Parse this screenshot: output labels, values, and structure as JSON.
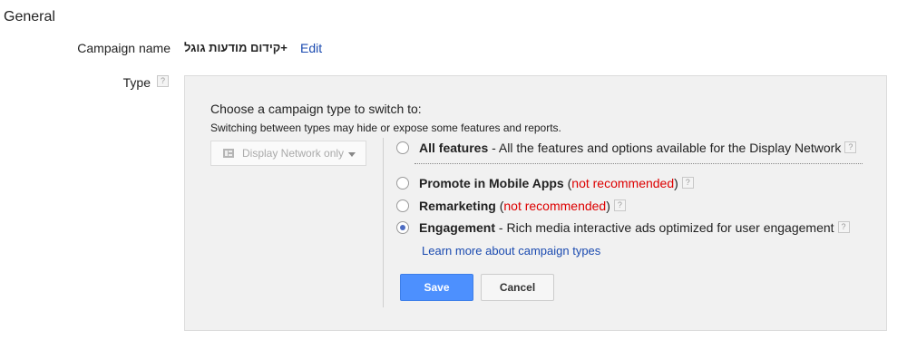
{
  "section_title": "General",
  "campaign": {
    "label": "Campaign name",
    "value": "+קידום מודעות גוגל",
    "edit_label": "Edit"
  },
  "type": {
    "label": "Type",
    "help_icon": "?",
    "panel": {
      "heading": "Choose a campaign type to switch to:",
      "subheading": "Switching between types may hide or expose some features and reports.",
      "network_select": {
        "selected": "Display Network only"
      },
      "options": [
        {
          "title": "All features",
          "sep": " - ",
          "description": "All the features and options available for the Display Network",
          "checked": false
        },
        {
          "title": "Promote in Mobile Apps",
          "open": " (",
          "warning": "not recommended",
          "close": ")",
          "checked": false
        },
        {
          "title": "Remarketing",
          "open": " (",
          "warning": "not recommended",
          "close": ")",
          "checked": false
        },
        {
          "title": "Engagement",
          "sep": " - ",
          "description": "Rich media interactive ads optimized for user engagement",
          "checked": true
        }
      ],
      "learn_more": "Learn more about campaign types",
      "save_label": "Save",
      "cancel_label": "Cancel"
    }
  },
  "colors": {
    "link": "#1a4ab0",
    "warning": "#dd0000",
    "primary_button": "#4d90fe"
  }
}
